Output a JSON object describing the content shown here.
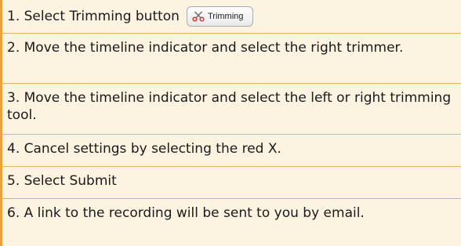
{
  "steps": [
    {
      "text": "1. Select Trimming button"
    },
    {
      "text": "2.  Move the timeline indicator and select the right trimmer."
    },
    {
      "text": "3.  Move the timeline indicator and select the left or right trimming tool."
    },
    {
      "text": "4.  Cancel settings by selecting the red X."
    },
    {
      "text": "5.  Select Submit"
    },
    {
      "text": "6. A link to the recording will be sent to you by email."
    }
  ],
  "trimming_button": {
    "label": "Trimming",
    "icon": "scissors-icon"
  },
  "colors": {
    "row_background": "#fdf3e1",
    "divider": "#e3b36f",
    "accent_rule": "#e9a13b",
    "icon_accent": "#d92e2e"
  }
}
